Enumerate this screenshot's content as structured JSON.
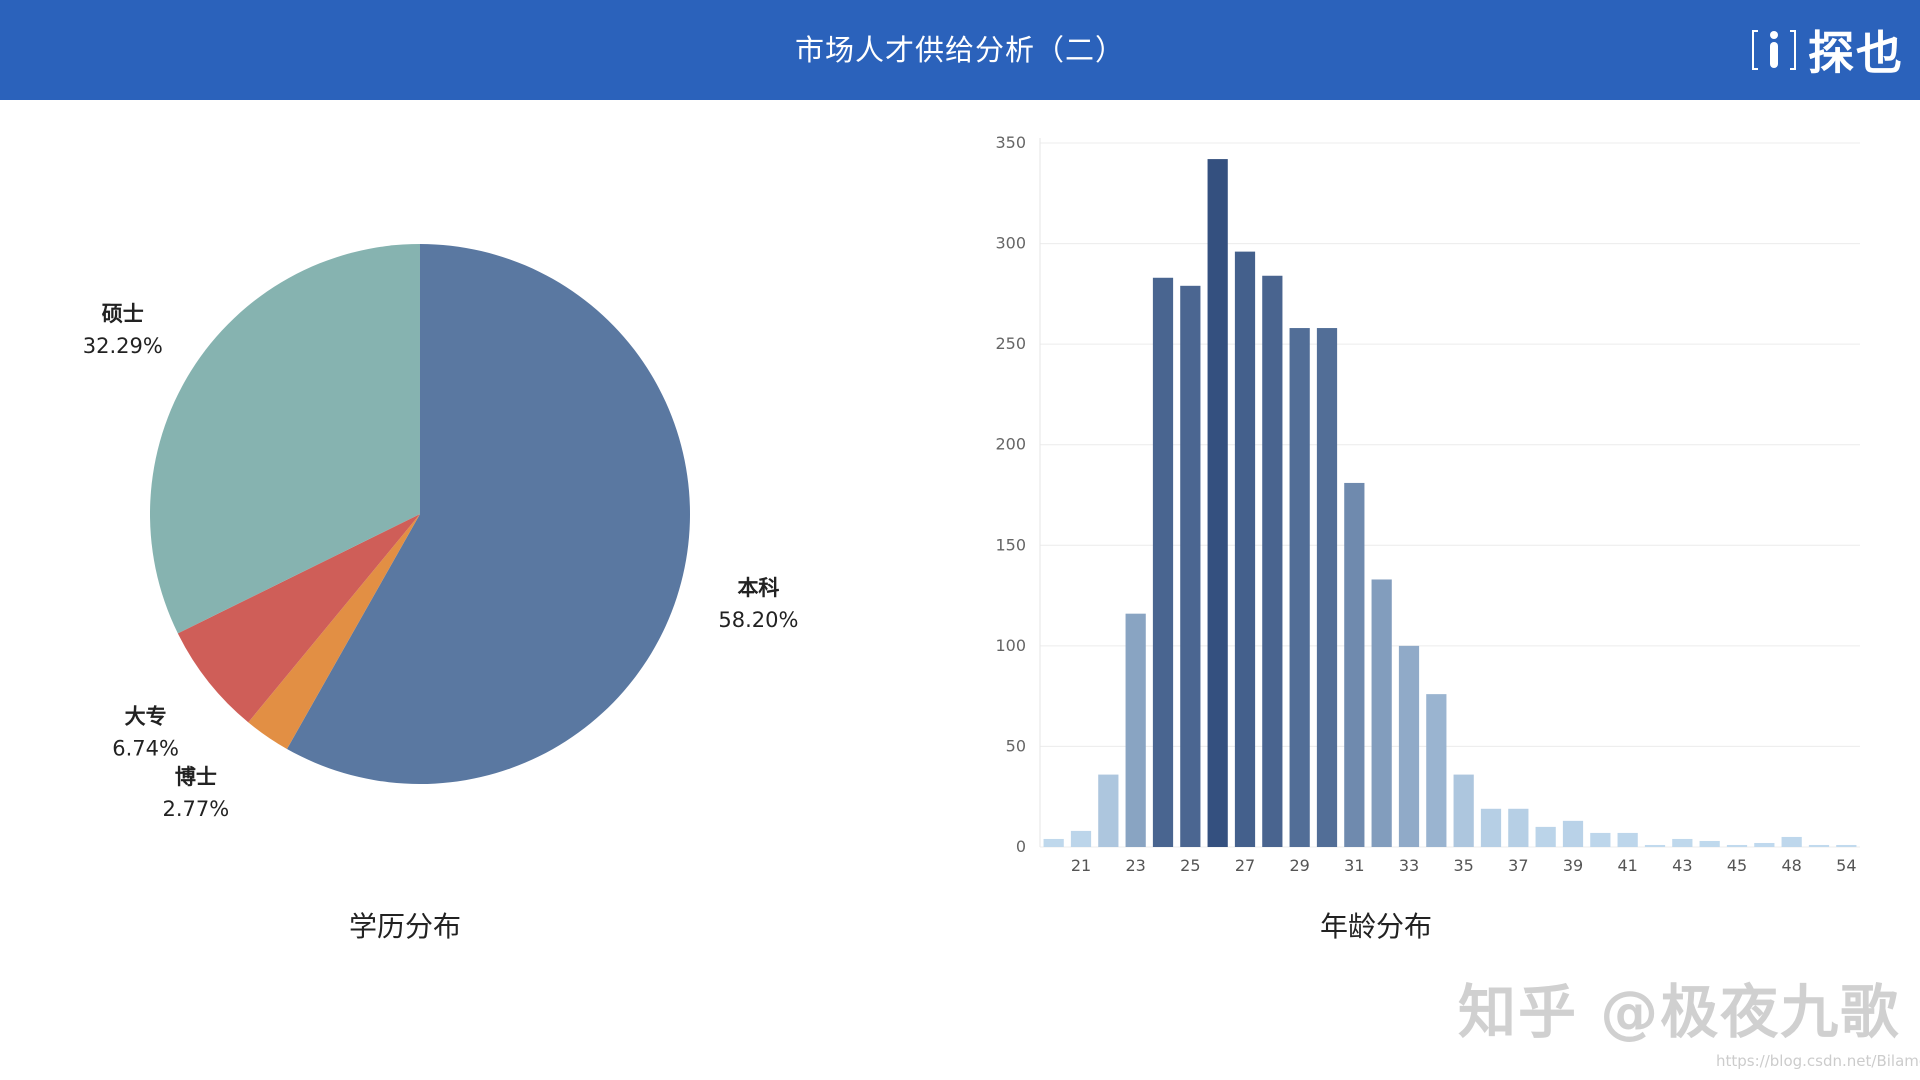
{
  "header": {
    "title": "市场人才供给分析（二）",
    "logo_text": "探也",
    "bg_color": "#2b62bb"
  },
  "captions": {
    "education": "学历分布",
    "age": "年龄分布"
  },
  "watermark": {
    "text": "知乎 @极夜九歌",
    "url": "https://blog.csdn.net/Bilamo"
  },
  "chart_data": [
    {
      "type": "pie",
      "caption": "学历分布",
      "slices": [
        {
          "label": "本科",
          "percent_label": "58.20%",
          "value": 58.2,
          "color": "#5a78a1"
        },
        {
          "label": "博士",
          "percent_label": "2.77%",
          "value": 2.77,
          "color": "#e28f44"
        },
        {
          "label": "大专",
          "percent_label": "6.74%",
          "value": 6.74,
          "color": "#cf5e58"
        },
        {
          "label": "硕士",
          "percent_label": "32.29%",
          "value": 32.29,
          "color": "#86b3b0"
        }
      ]
    },
    {
      "type": "bar",
      "caption": "年龄分布",
      "x": [
        20,
        21,
        22,
        23,
        24,
        25,
        26,
        27,
        28,
        29,
        30,
        31,
        32,
        33,
        34,
        35,
        36,
        37,
        38,
        39,
        40,
        41,
        42,
        43,
        44,
        45,
        46,
        48,
        50,
        54
      ],
      "values": [
        4,
        8,
        36,
        116,
        283,
        279,
        342,
        296,
        284,
        258,
        258,
        181,
        133,
        100,
        76,
        36,
        19,
        19,
        10,
        13,
        7,
        7,
        1,
        4,
        3,
        1,
        2,
        5,
        1,
        1
      ],
      "xticks": [
        21,
        23,
        25,
        27,
        29,
        31,
        33,
        35,
        37,
        39,
        41,
        43,
        45,
        48,
        54
      ],
      "yticks": [
        0,
        50,
        100,
        150,
        200,
        250,
        300,
        350
      ],
      "ylim": [
        0,
        350
      ],
      "grid": true,
      "color_low": "#c2dbef",
      "color_high": "#34507f"
    }
  ]
}
